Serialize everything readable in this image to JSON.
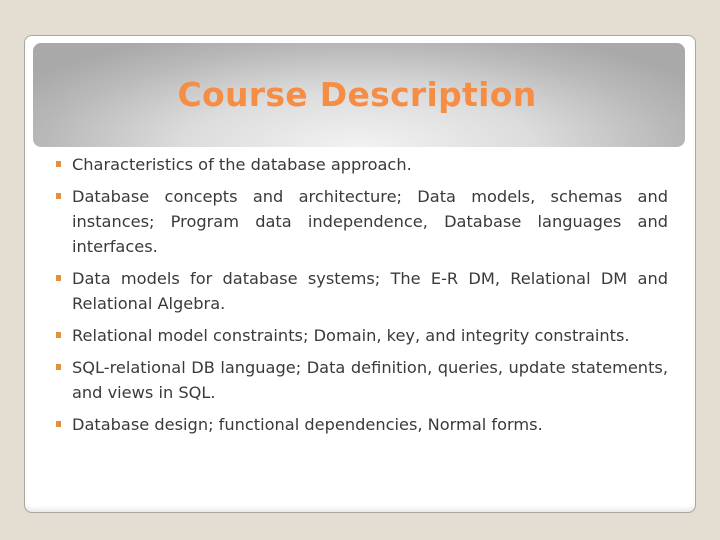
{
  "slide": {
    "title": "Course Description",
    "colors": {
      "title": "#f68d45",
      "bullet": "#e0913a",
      "text": "#3a3a3a",
      "background": "#e3ddd2"
    },
    "bullets": [
      {
        "icon": "square-bullet-icon",
        "text": "Characteristics of the database approach."
      },
      {
        "icon": "square-bullet-icon",
        "text": "Database concepts and architecture; Data models, schemas and instances; Program data independence, Database languages and interfaces."
      },
      {
        "icon": "square-bullet-icon",
        "text": "Data models for database systems; The E-R DM, Relational DM and Relational Algebra."
      },
      {
        "icon": "square-bullet-icon",
        "text": "Relational model constraints; Domain, key, and integrity constraints."
      },
      {
        "icon": "square-bullet-icon",
        "text": "SQL-relational DB language; Data definition, queries, update statements, and views in SQL."
      },
      {
        "icon": "square-bullet-icon",
        "text": "Database design; functional dependencies, Normal forms."
      }
    ]
  }
}
